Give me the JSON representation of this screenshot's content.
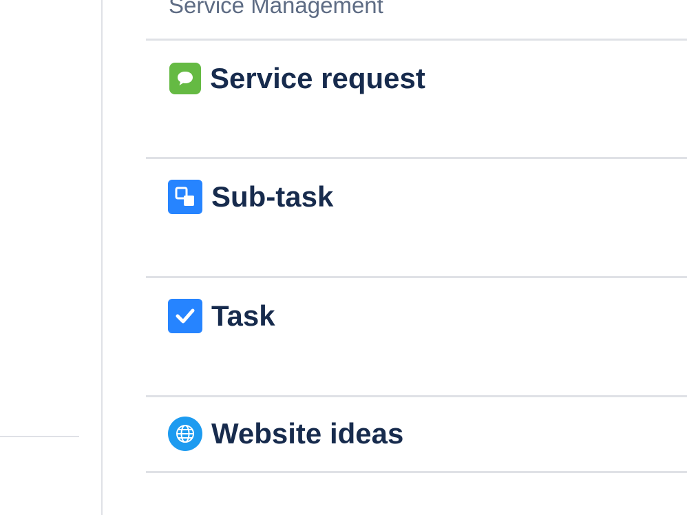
{
  "section": {
    "title": "Service Management"
  },
  "issue_types": [
    {
      "label": "Service request",
      "icon": "speech-bubble-icon",
      "color": "#65ba43"
    },
    {
      "label": "Sub-task",
      "icon": "subtask-icon",
      "color": "#2684ff"
    },
    {
      "label": "Task",
      "icon": "checkmark-icon",
      "color": "#2684ff"
    },
    {
      "label": "Website ideas",
      "icon": "globe-icon",
      "color": "#1d9bf0"
    }
  ]
}
